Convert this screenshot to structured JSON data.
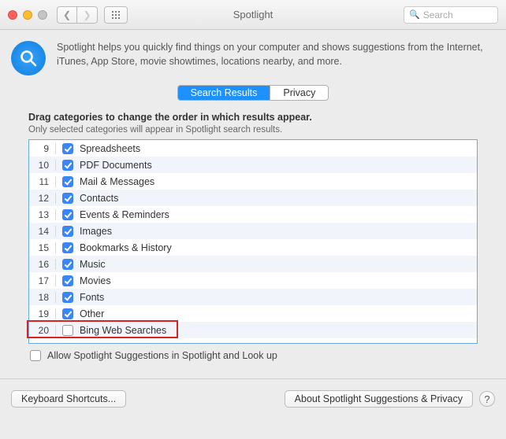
{
  "window": {
    "title": "Spotlight",
    "search_placeholder": "Search"
  },
  "intro": "Spotlight helps you quickly find things on your computer and shows suggestions from the Internet, iTunes, App Store, movie showtimes, locations nearby, and more.",
  "tabs": {
    "results": "Search Results",
    "privacy": "Privacy"
  },
  "drag_heading": "Drag categories to change the order in which results appear.",
  "drag_sub": "Only selected categories will appear in Spotlight search results.",
  "categories": [
    {
      "n": 9,
      "label": "Spreadsheets",
      "checked": true
    },
    {
      "n": 10,
      "label": "PDF Documents",
      "checked": true
    },
    {
      "n": 11,
      "label": "Mail & Messages",
      "checked": true
    },
    {
      "n": 12,
      "label": "Contacts",
      "checked": true
    },
    {
      "n": 13,
      "label": "Events & Reminders",
      "checked": true
    },
    {
      "n": 14,
      "label": "Images",
      "checked": true
    },
    {
      "n": 15,
      "label": "Bookmarks & History",
      "checked": true
    },
    {
      "n": 16,
      "label": "Music",
      "checked": true
    },
    {
      "n": 17,
      "label": "Movies",
      "checked": true
    },
    {
      "n": 18,
      "label": "Fonts",
      "checked": true
    },
    {
      "n": 19,
      "label": "Other",
      "checked": true
    },
    {
      "n": 20,
      "label": "Bing Web Searches",
      "checked": false
    }
  ],
  "allow_label": "Allow Spotlight Suggestions in Spotlight and Look up",
  "allow_checked": false,
  "footer": {
    "shortcuts": "Keyboard Shortcuts...",
    "about": "About Spotlight Suggestions & Privacy",
    "help": "?"
  }
}
